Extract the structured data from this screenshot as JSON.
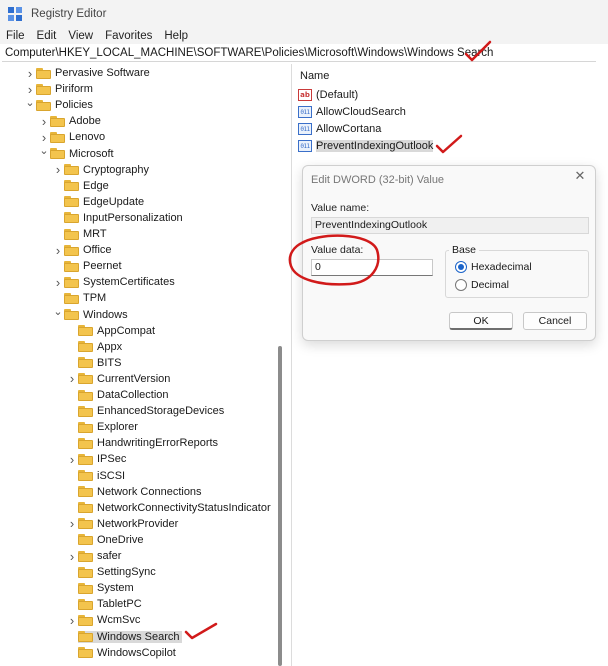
{
  "window": {
    "title": "Registry Editor"
  },
  "menu": [
    "File",
    "Edit",
    "View",
    "Favorites",
    "Help"
  ],
  "address": "Computer\\HKEY_LOCAL_MACHINE\\SOFTWARE\\Policies\\Microsoft\\Windows\\Windows Search",
  "tree": [
    {
      "label": "Pervasive Software",
      "chevron": "right"
    },
    {
      "label": "Piriform",
      "chevron": "right"
    },
    {
      "label": "Policies",
      "chevron": "down"
    },
    {
      "label": "Adobe",
      "chevron": "right"
    },
    {
      "label": "Lenovo",
      "chevron": "right"
    },
    {
      "label": "Microsoft",
      "chevron": "down"
    },
    {
      "label": "Cryptography",
      "chevron": "right"
    },
    {
      "label": "Edge",
      "chevron": ""
    },
    {
      "label": "EdgeUpdate",
      "chevron": ""
    },
    {
      "label": "InputPersonalization",
      "chevron": ""
    },
    {
      "label": "MRT",
      "chevron": ""
    },
    {
      "label": "Office",
      "chevron": "right"
    },
    {
      "label": "Peernet",
      "chevron": ""
    },
    {
      "label": "SystemCertificates",
      "chevron": "right"
    },
    {
      "label": "TPM",
      "chevron": ""
    },
    {
      "label": "Windows",
      "chevron": "down"
    },
    {
      "label": "AppCompat",
      "chevron": ""
    },
    {
      "label": "Appx",
      "chevron": ""
    },
    {
      "label": "BITS",
      "chevron": ""
    },
    {
      "label": "CurrentVersion",
      "chevron": "right"
    },
    {
      "label": "DataCollection",
      "chevron": ""
    },
    {
      "label": "EnhancedStorageDevices",
      "chevron": ""
    },
    {
      "label": "Explorer",
      "chevron": ""
    },
    {
      "label": "HandwritingErrorReports",
      "chevron": ""
    },
    {
      "label": "IPSec",
      "chevron": "right"
    },
    {
      "label": "iSCSI",
      "chevron": ""
    },
    {
      "label": "Network Connections",
      "chevron": ""
    },
    {
      "label": "NetworkConnectivityStatusIndicator",
      "chevron": ""
    },
    {
      "label": "NetworkProvider",
      "chevron": "right"
    },
    {
      "label": "OneDrive",
      "chevron": ""
    },
    {
      "label": "safer",
      "chevron": "right"
    },
    {
      "label": "SettingSync",
      "chevron": ""
    },
    {
      "label": "System",
      "chevron": ""
    },
    {
      "label": "TabletPC",
      "chevron": ""
    },
    {
      "label": "WcmSvc",
      "chevron": "right"
    },
    {
      "label": "Windows Search",
      "chevron": "",
      "selected": true
    },
    {
      "label": "WindowsCopilot",
      "chevron": ""
    }
  ],
  "values_pane": {
    "column_header": "Name",
    "rows": [
      {
        "name": "(Default)",
        "icon": "string-value-icon",
        "badge": "ab"
      },
      {
        "name": "AllowCloudSearch",
        "icon": "dword-value-icon",
        "badge": "011"
      },
      {
        "name": "AllowCortana",
        "icon": "dword-value-icon",
        "badge": "011"
      },
      {
        "name": "PreventIndexingOutlook",
        "icon": "dword-value-icon",
        "badge": "011",
        "selected": true
      }
    ]
  },
  "dialog": {
    "title": "Edit DWORD (32-bit) Value",
    "close_glyph": "✕",
    "value_name_label": "Value name:",
    "value_name": "PreventIndexingOutlook",
    "value_data_label": "Value data:",
    "value_data": "0",
    "base_label": "Base",
    "hex_label": "Hexadecimal",
    "dec_label": "Decimal",
    "base_selected": "Hexadecimal",
    "ok_label": "OK",
    "cancel_label": "Cancel"
  },
  "colors": {
    "annotation": "#d11a1a",
    "selection": "#d9d9d9",
    "folder": "#f3c44d"
  }
}
